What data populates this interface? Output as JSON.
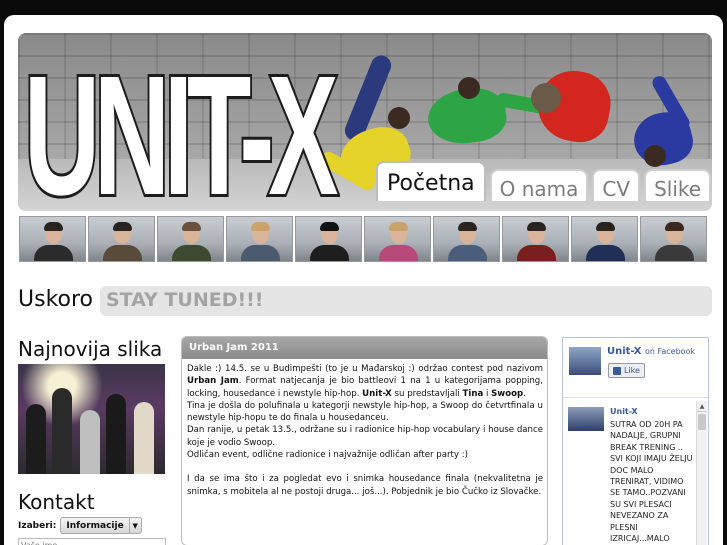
{
  "header": {
    "logo_text": "UNIT-X",
    "tabs": [
      {
        "label": "Početna",
        "active": true
      },
      {
        "label": "O nama",
        "active": false
      },
      {
        "label": "CV",
        "active": false
      },
      {
        "label": "Slike",
        "active": false
      }
    ]
  },
  "members_count": 10,
  "coming_soon": {
    "label": "Uskoro",
    "text": "STAY TUNED!!!"
  },
  "left": {
    "latest_photo_heading": "Najnovija slika",
    "contact_heading": "Kontakt",
    "choose_label": "Izaberi:",
    "choose_value": "Informacije",
    "name_placeholder": "Vaše ime"
  },
  "article": {
    "title": "Urban Jam 2011",
    "p1_a": "Dakle :) 14.5. se u Budimpešti (to je u Mađarskoj :) održao contest pod nazivom ",
    "p1_b": "Urban Jam",
    "p1_c": ". Format natjecanja je bio battleovi 1 na 1 u kategorijama popping, locking, housedance i newstyle hip-hop. ",
    "p1_d": "Unit-X",
    "p1_e": " su predstavljali ",
    "p1_f": "Tina",
    "p1_g": " i ",
    "p1_h": "Swoop",
    "p1_i": ".",
    "p2": "Tina je došla do polufinala u kategorji newstyle hip-hop, a Swoop do četvrtfinala u newstyle hip-hopu te do finala u housedanceu.",
    "p3": "Dan ranije, u petak 13.5., održane su i radionice hip-hop vocabulary i house dance koje je vodio Swoop.",
    "p4": "Odličan event, odlične radionice i najvažnije odličan after party :)",
    "p5": "I da se ima što i za pogledat evo i snimka housedance finala (nekvalitetna je snimka, s mobitela al ne postoji druga... još...). Pobjednik je bio Čučko iz Slovačke."
  },
  "facebook": {
    "page_name": "Unit-X",
    "on_facebook": "on Facebook",
    "like_label": "Like",
    "post_author": "Unit-X",
    "post_text": "SUTRA OD 20H PA NADALJE, GRUPNI BREAK TRENING .. SVI KOJI IMAJU ŽELJU DOC MALO TRENIRAT, VIDIMO SE TAMO..POZVANI SU SVI PLESACI NEVEZANO ZA PLESNI IZRICAJ...MALO CAGICE NECE"
  }
}
